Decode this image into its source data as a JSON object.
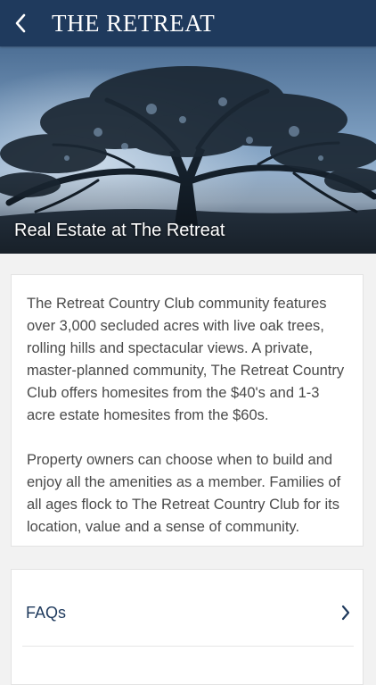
{
  "navbar": {
    "back_icon": "chevron-left-icon",
    "title": "THE RETREAT",
    "background": "#1f3a5d"
  },
  "hero": {
    "image": "live-oak-tree-photo",
    "caption": "Real Estate at The Retreat"
  },
  "description": {
    "paragraph_1": "The Retreat Country Club community features over 3,000 secluded acres with live oak trees, rolling hills and spectacular views. A private, master-planned community, The Retreat Country Club offers homesites from the $40's and 1-3 acre estate homesites from the $60s.",
    "paragraph_2": "Property owners can choose when to build and enjoy all the amenities as a member. Families of all ages flock to The Retreat Country Club for its location, value and a sense of community."
  },
  "links": [
    {
      "label": "FAQs",
      "icon": "chevron-right-icon"
    }
  ],
  "colors": {
    "accent": "#1f3a5d",
    "text": "#4a4a4a",
    "background": "#f2f2f2"
  }
}
